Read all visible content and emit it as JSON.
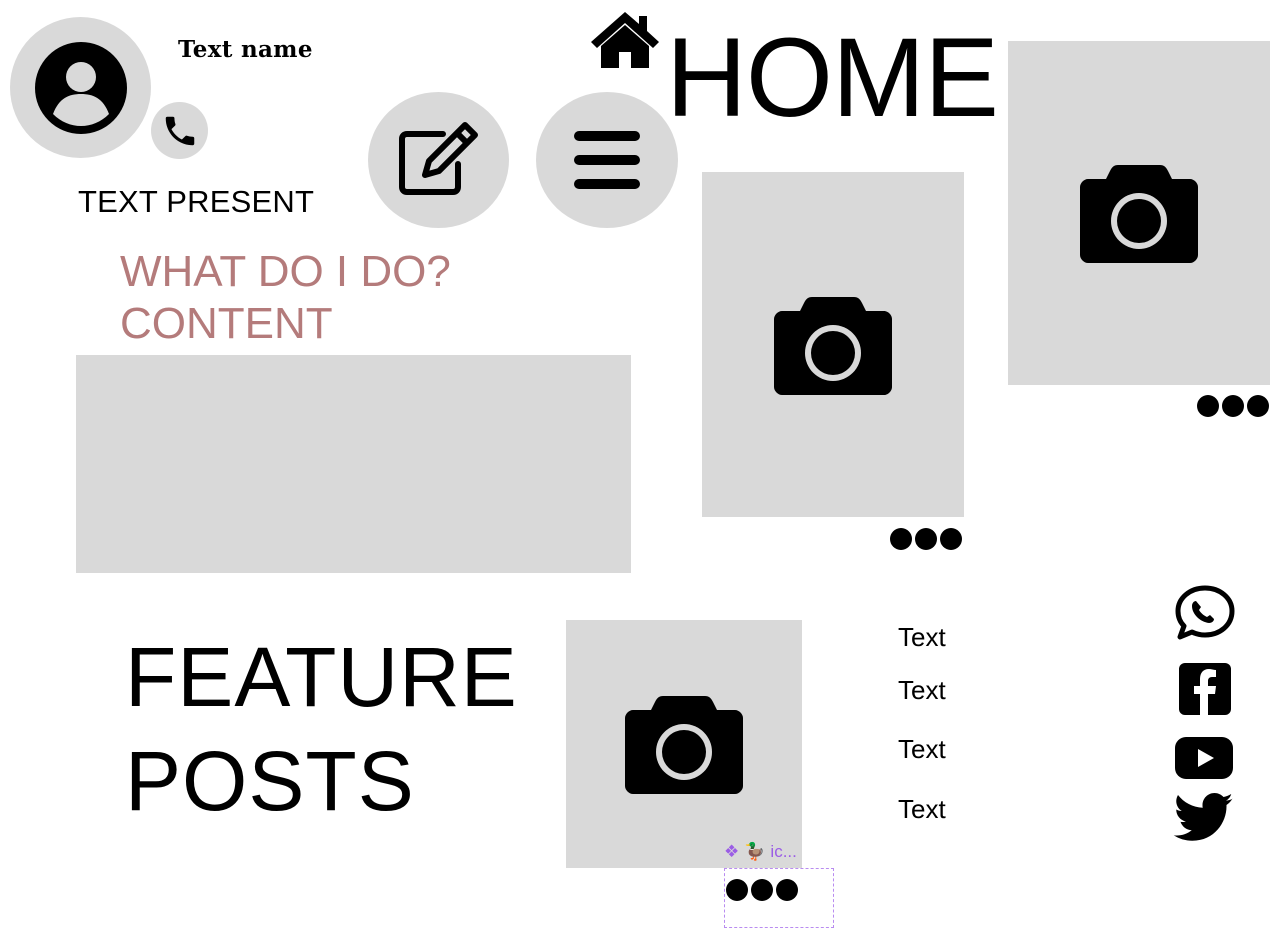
{
  "profile": {
    "name": "Text name",
    "subtitle": "TEXT PRESENT"
  },
  "header": {
    "title": "HOME"
  },
  "about": {
    "line1": "WHAT DO I DO?",
    "line2": "CONTENT"
  },
  "feature": {
    "line1": "FEATURE",
    "line2": "POSTS"
  },
  "text_items": [
    "Text",
    "Text",
    "Text",
    "Text"
  ],
  "selection": {
    "label": "ic..."
  },
  "colors": {
    "placeholder": "#d9d9d9",
    "accent_text": "#b47b7b",
    "icon": "#000000",
    "selection": "#9b5de5"
  },
  "icons": {
    "avatar": "user-circle-icon",
    "phone": "phone-icon",
    "edit": "edit-icon",
    "menu": "hamburger-menu-icon",
    "home": "home-icon",
    "camera": "camera-icon",
    "more": "more-dots-icon",
    "whatsapp": "whatsapp-icon",
    "facebook": "facebook-icon",
    "youtube": "youtube-icon",
    "twitter": "twitter-icon"
  }
}
